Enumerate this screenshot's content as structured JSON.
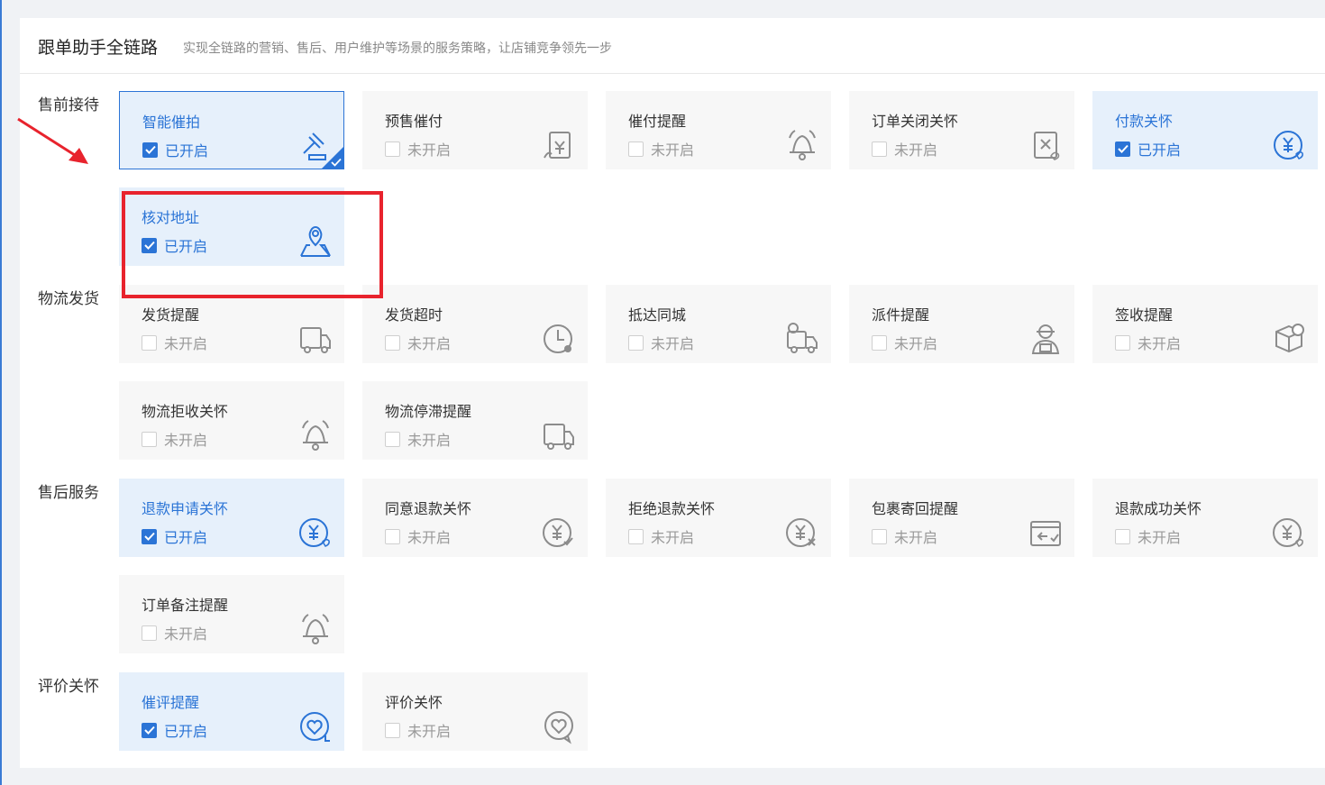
{
  "header": {
    "title": "跟单助手全链路",
    "subtitle": "实现全链路的营销、售后、用户维护等场景的服务策略，让店铺竞争领先一步"
  },
  "status_labels": {
    "on": "已开启",
    "off": "未开启"
  },
  "sections": [
    {
      "label": "售前接待",
      "cards": [
        {
          "name": "智能催拍",
          "on": true,
          "icon": "auction-hammer-icon"
        },
        {
          "name": "预售催付",
          "on": false,
          "icon": "presale-payment-icon"
        },
        {
          "name": "催付提醒",
          "on": false,
          "icon": "bell-icon"
        },
        {
          "name": "订单关闭关怀",
          "on": false,
          "icon": "order-closed-care-icon"
        },
        {
          "name": "付款关怀",
          "on": true,
          "icon": "payment-care-icon"
        },
        {
          "name": "核对地址",
          "on": true,
          "icon": "map-location-icon"
        }
      ]
    },
    {
      "label": "物流发货",
      "cards": [
        {
          "name": "发货提醒",
          "on": false,
          "icon": "truck-icon"
        },
        {
          "name": "发货超时",
          "on": false,
          "icon": "clock-alert-icon"
        },
        {
          "name": "抵达同城",
          "on": false,
          "icon": "truck-location-icon"
        },
        {
          "name": "派件提醒",
          "on": false,
          "icon": "courier-icon"
        },
        {
          "name": "签收提醒",
          "on": false,
          "icon": "package-check-icon"
        },
        {
          "name": "物流拒收关怀",
          "on": false,
          "icon": "bell-icon"
        },
        {
          "name": "物流停滞提醒",
          "on": false,
          "icon": "truck-icon"
        }
      ]
    },
    {
      "label": "售后服务",
      "cards": [
        {
          "name": "退款申请关怀",
          "on": true,
          "icon": "refund-care-icon"
        },
        {
          "name": "同意退款关怀",
          "on": false,
          "icon": "refund-check-icon"
        },
        {
          "name": "拒绝退款关怀",
          "on": false,
          "icon": "refund-reject-icon"
        },
        {
          "name": "包裹寄回提醒",
          "on": false,
          "icon": "package-return-icon"
        },
        {
          "name": "退款成功关怀",
          "on": false,
          "icon": "refund-success-icon"
        },
        {
          "name": "订单备注提醒",
          "on": false,
          "icon": "bell-icon"
        }
      ]
    },
    {
      "label": "评价关怀",
      "cards": [
        {
          "name": "催评提醒",
          "on": true,
          "icon": "review-reminder-icon"
        },
        {
          "name": "评价关怀",
          "on": false,
          "icon": "review-care-icon"
        }
      ]
    }
  ],
  "colors": {
    "accent": "#2b74d6",
    "highlight": "#e8232d"
  }
}
